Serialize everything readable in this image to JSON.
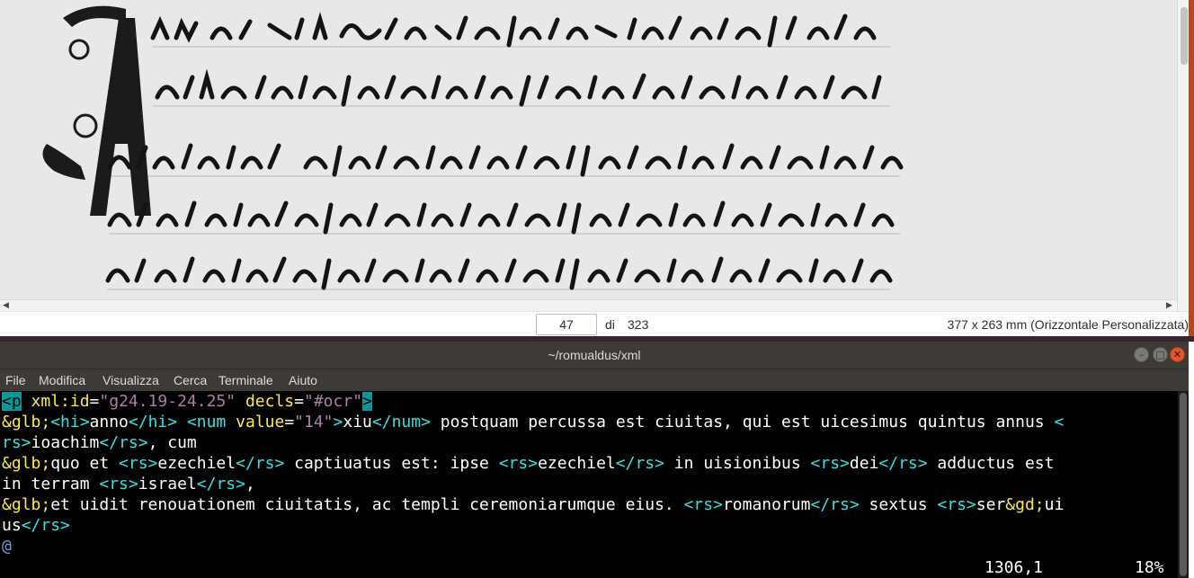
{
  "viewer": {
    "current_page": "47",
    "of_label": "di",
    "total_pages": "323",
    "document_size": "377 x 263 mm (Orizzontale Personalizzata)",
    "scan_image": "manuscript-page-scan"
  },
  "terminal": {
    "title": "~/romualdus/xml",
    "menu": [
      "File",
      "Modifica",
      "Visualizza",
      "Cerca",
      "Terminale",
      "Aiuto"
    ],
    "status_position": "1306,1",
    "status_percent": "18%",
    "cursor_char": "@",
    "lines": [
      [
        "<p",
        " xml:id",
        "=",
        "\"g24.19-24.25\"",
        " decls",
        "=",
        "\"#ocr\"",
        ">"
      ],
      [
        "&glb;",
        "<hi>",
        "anno",
        "</hi>",
        " ",
        "<num",
        " value",
        "=",
        "\"14\"",
        ">",
        "xiu",
        "</num>",
        " postquam percussa est ciuitas, qui est uicesimus quintus annus ",
        "<"
      ],
      [
        "rs>",
        "ioachim",
        "</rs>",
        ", cum"
      ],
      [
        "&glb;",
        "quo et ",
        "<rs>",
        "ezechiel",
        "</rs>",
        " captiuatus est: ipse ",
        "<rs>",
        "ezechiel",
        "</rs>",
        " in uisionibus ",
        "<rs>",
        "dei",
        "</rs>",
        " adductus est"
      ],
      [
        "in terram ",
        "<rs>",
        "israel",
        "</rs>",
        ","
      ],
      [
        "&glb;",
        "et uidit renouationem ciuitatis, ac templi ceremoniarumque eius. ",
        "<rs>",
        "romanorum",
        "</rs>",
        " sextus ",
        "<rs>",
        "ser",
        "&gd;",
        "ui"
      ],
      [
        "us",
        "</rs>"
      ]
    ]
  },
  "colors": {
    "tag": "#34e2e2",
    "attribute": "#fce94f",
    "string": "#ad7fa8",
    "entity": "#fce94f",
    "highlight": "#06989a",
    "titlebar": "#3c3b37",
    "close_button": "#e1572a"
  }
}
